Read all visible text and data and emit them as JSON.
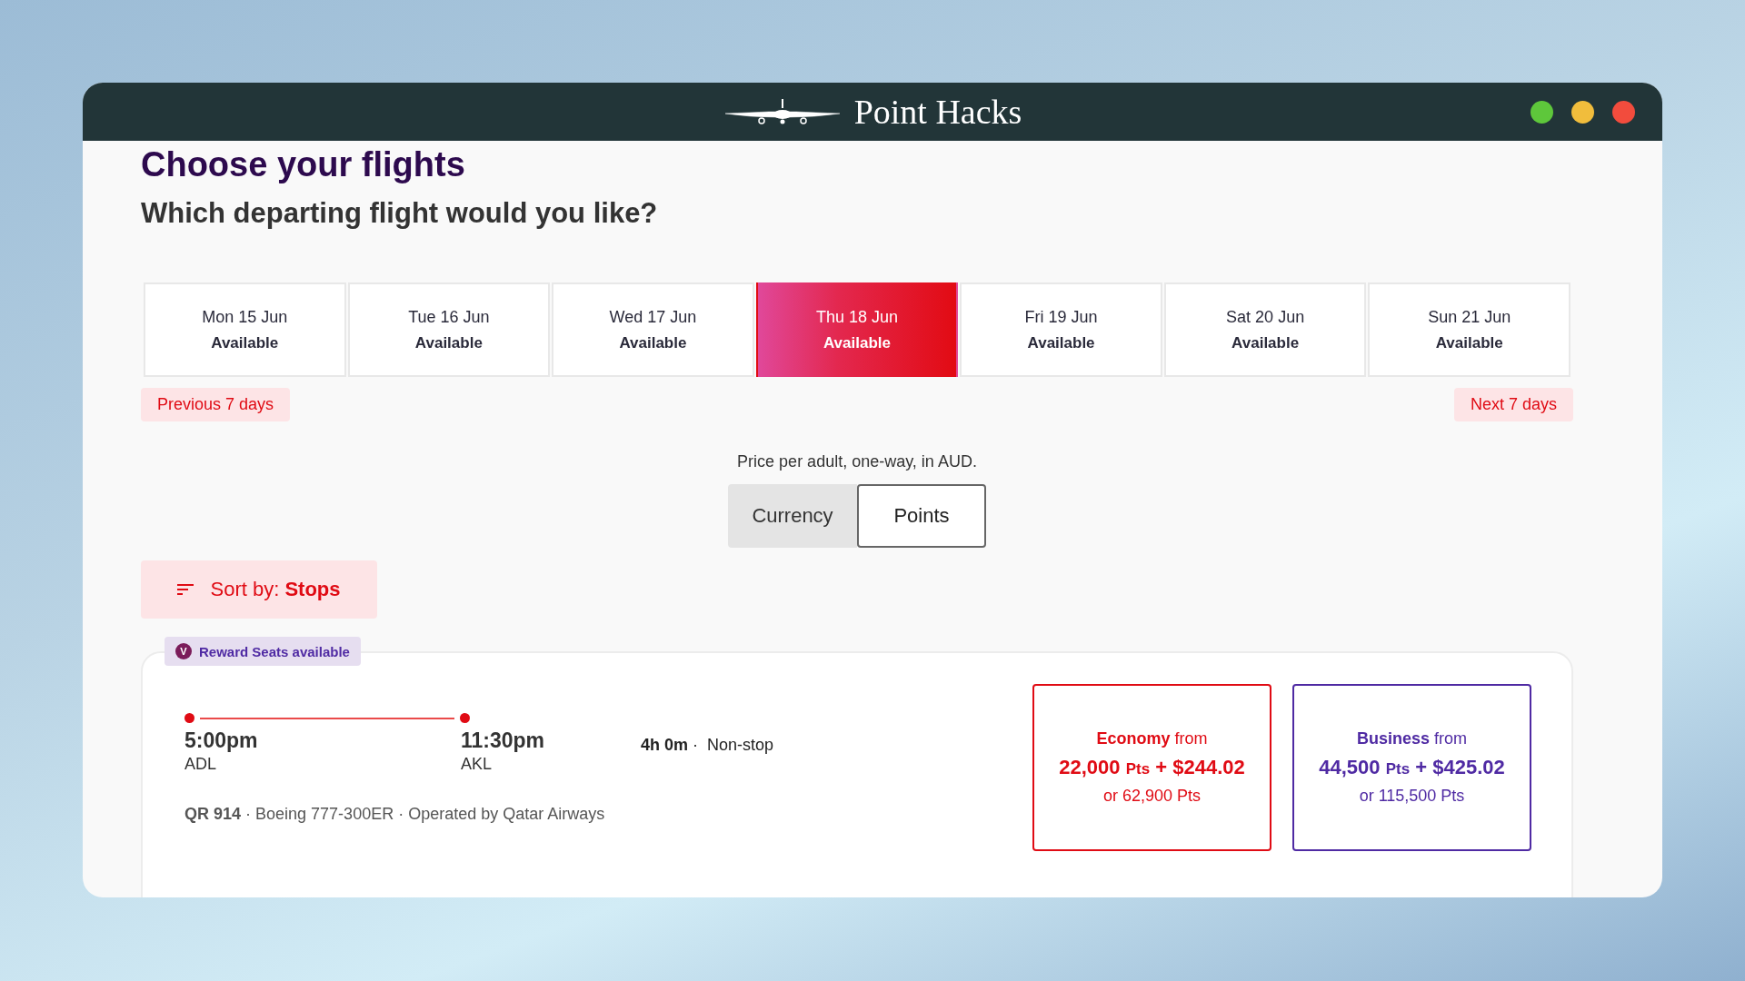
{
  "window": {
    "title": "Point Hacks"
  },
  "heading": "Choose your flights",
  "subheading": "Which departing flight would you like?",
  "dates": [
    {
      "day": "Mon 15 Jun",
      "status": "Available",
      "selected": false
    },
    {
      "day": "Tue 16 Jun",
      "status": "Available",
      "selected": false
    },
    {
      "day": "Wed 17 Jun",
      "status": "Available",
      "selected": false
    },
    {
      "day": "Thu 18 Jun",
      "status": "Available",
      "selected": true
    },
    {
      "day": "Fri 19 Jun",
      "status": "Available",
      "selected": false
    },
    {
      "day": "Sat 20 Jun",
      "status": "Available",
      "selected": false
    },
    {
      "day": "Sun 21 Jun",
      "status": "Available",
      "selected": false
    }
  ],
  "nav": {
    "previous": "Previous 7 days",
    "next": "Next 7 days"
  },
  "price_note": "Price per adult, one-way, in AUD.",
  "price_toggle": [
    {
      "label": "Currency",
      "selected": false
    },
    {
      "label": "Points",
      "selected": true
    }
  ],
  "sort": {
    "label": "Sort by: **Stops**"
  },
  "flight": {
    "badge": "Reward Seats available",
    "badge_icon": "V",
    "departure": {
      "time": "5:00pm",
      "airport": "ADL"
    },
    "arrival": {
      "time": "11:30pm",
      "airport": "AKL"
    },
    "summary": "**4h 0m** ·  Non-stop",
    "details": "**QR 914** · Boeing 777-300ER · Operated by Qatar Airways",
    "fares": [
      {
        "title": "**Economy** from",
        "points": "22,000",
        "unit": "Pts",
        "cash": "+ $244.02",
        "alt": "or 62,900 Pts",
        "color": "#e00b14"
      },
      {
        "title": "**Business** from",
        "points": "44,500",
        "unit": "Pts",
        "cash": "+ $425.02",
        "alt": "or 115,500 Pts",
        "color": "#4f2aa3"
      }
    ]
  }
}
